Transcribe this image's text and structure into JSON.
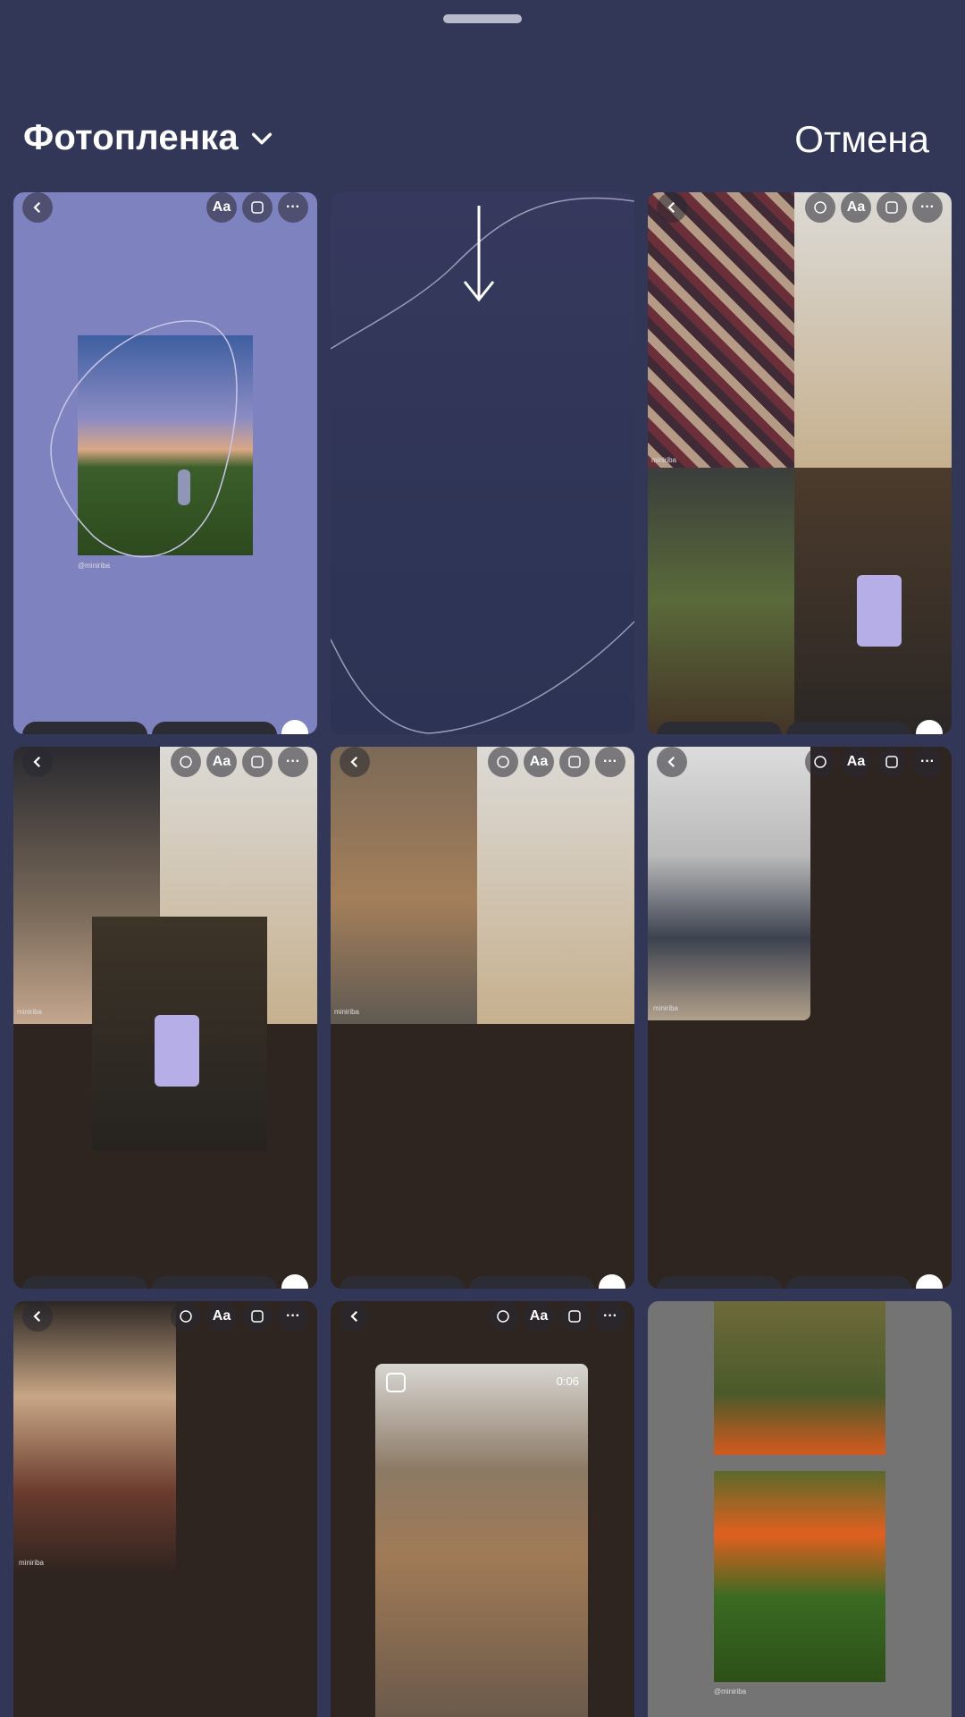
{
  "header": {
    "title": "Фотопленка",
    "cancel_label": "Отмена"
  },
  "tiles": [
    {
      "type": "story",
      "username": "@miniriba"
    },
    {
      "type": "drawing"
    },
    {
      "type": "story-collage",
      "username": "miniriba"
    },
    {
      "type": "story-collage",
      "username": "miniriba"
    },
    {
      "type": "story-collage",
      "username": "miniriba"
    },
    {
      "type": "story",
      "username": "miniriba"
    },
    {
      "type": "story",
      "username": "miniriba"
    },
    {
      "type": "video",
      "duration": "0:06"
    },
    {
      "type": "story",
      "username": "@miniriba"
    }
  ],
  "story_tools": {
    "text_label": "Aa",
    "more_label": "···"
  },
  "colors": {
    "background": "#323657",
    "tile_lilac": "#7e82bf",
    "tile_dark": "#2e2420",
    "tile_gray": "#747474"
  }
}
